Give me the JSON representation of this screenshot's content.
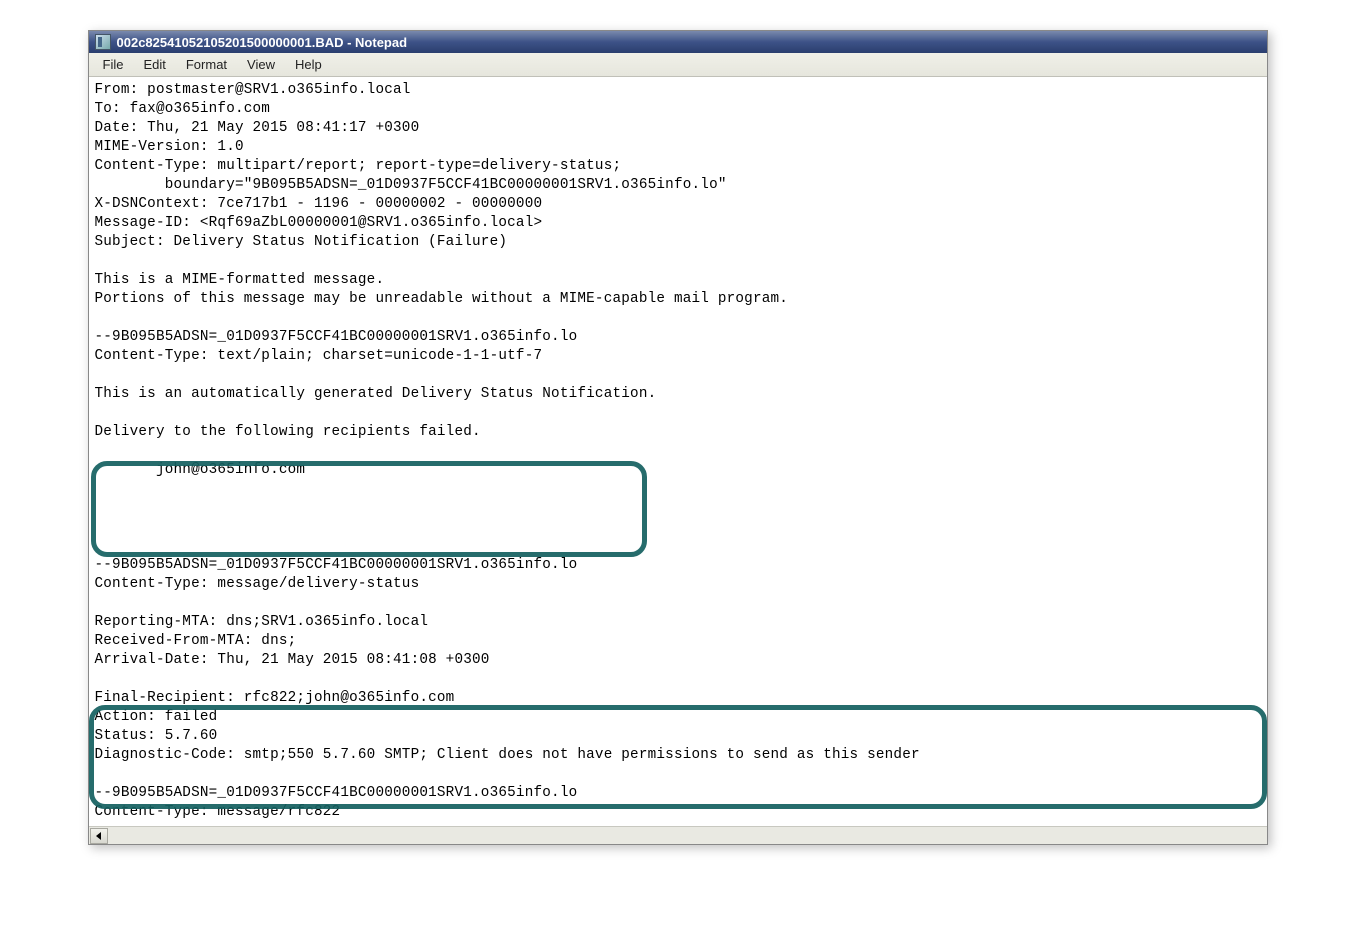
{
  "window": {
    "title": "002c82541052105201500000001.BAD - Notepad"
  },
  "menubar": {
    "items": [
      "File",
      "Edit",
      "Format",
      "View",
      "Help"
    ]
  },
  "content": {
    "text": "From: postmaster@SRV1.o365info.local\nTo: fax@o365info.com\nDate: Thu, 21 May 2015 08:41:17 +0300\nMIME-Version: 1.0\nContent-Type: multipart/report; report-type=delivery-status;\n        boundary=\"9B095B5ADSN=_01D0937F5CCF41BC00000001SRV1.o365info.lo\"\nX-DSNContext: 7ce717b1 - 1196 - 00000002 - 00000000\nMessage-ID: <Rqf69aZbL00000001@SRV1.o365info.local>\nSubject: Delivery Status Notification (Failure)\n\nThis is a MIME-formatted message.\nPortions of this message may be unreadable without a MIME-capable mail program.\n\n--9B095B5ADSN=_01D0937F5CCF41BC00000001SRV1.o365info.lo\nContent-Type: text/plain; charset=unicode-1-1-utf-7\n\nThis is an automatically generated Delivery Status Notification.\n\nDelivery to the following recipients failed.\n\n       john@o365info.com\n\n\n\n\n--9B095B5ADSN=_01D0937F5CCF41BC00000001SRV1.o365info.lo\nContent-Type: message/delivery-status\n\nReporting-MTA: dns;SRV1.o365info.local\nReceived-From-MTA: dns;\nArrival-Date: Thu, 21 May 2015 08:41:08 +0300\n\nFinal-Recipient: rfc822;john@o365info.com\nAction: failed\nStatus: 5.7.60\nDiagnostic-Code: smtp;550 5.7.60 SMTP; Client does not have permissions to send as this sender\n\n--9B095B5ADSN=_01D0937F5CCF41BC00000001SRV1.o365info.lo\nContent-Type: message/rfc822\n"
  }
}
